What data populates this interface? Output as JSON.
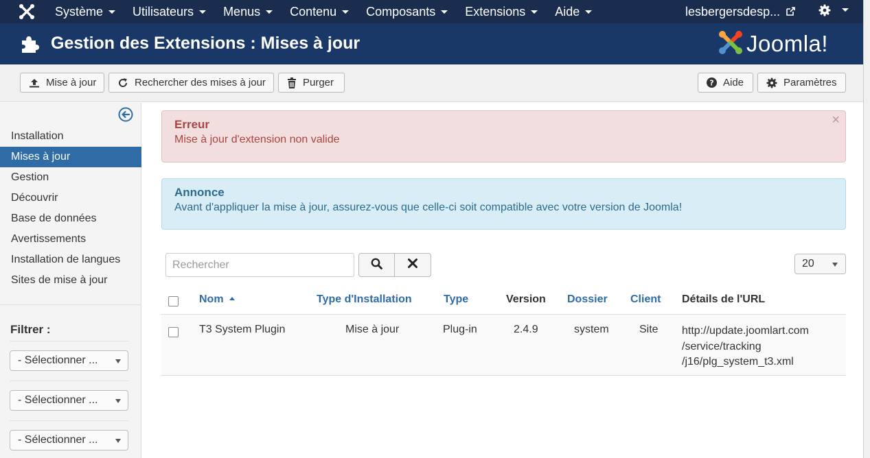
{
  "topnav": {
    "menu": [
      {
        "label": "Système"
      },
      {
        "label": "Utilisateurs"
      },
      {
        "label": "Menus"
      },
      {
        "label": "Contenu"
      },
      {
        "label": "Composants"
      },
      {
        "label": "Extensions"
      },
      {
        "label": "Aide"
      }
    ],
    "user": "lesbergersdesp..."
  },
  "header": {
    "title": "Gestion des Extensions : Mises à jour",
    "brand": "Joomla!"
  },
  "toolbar": {
    "update_label": "Mise à jour",
    "find_label": "Rechercher des mises à jour",
    "purge_label": "Purger",
    "help_label": "Aide",
    "options_label": "Paramètres"
  },
  "sidebar": {
    "items": [
      {
        "label": "Installation"
      },
      {
        "label": "Mises à jour"
      },
      {
        "label": "Gestion"
      },
      {
        "label": "Découvrir"
      },
      {
        "label": "Base de données"
      },
      {
        "label": "Avertissements"
      },
      {
        "label": "Installation de langues"
      },
      {
        "label": "Sites de mise à jour"
      }
    ],
    "active_index": 1,
    "filter_label": "Filtrer :",
    "filters": [
      {
        "value": "- Sélectionner ..."
      },
      {
        "value": "- Sélectionner ..."
      },
      {
        "value": "- Sélectionner ..."
      }
    ]
  },
  "alerts": {
    "error": {
      "heading": "Erreur",
      "message": "Mise à jour d'extension non valide"
    },
    "info": {
      "heading": "Annonce",
      "message": "Avant d'appliquer la mise à jour, assurez-vous que celle-ci soit compatible avec votre version de Joomla!"
    }
  },
  "search": {
    "placeholder": "Rechercher"
  },
  "list_limit": "20",
  "table": {
    "headers": {
      "name": "Nom",
      "install_type": "Type d'Installation",
      "type": "Type",
      "version": "Version",
      "folder": "Dossier",
      "client": "Client",
      "url": "Détails de l'URL"
    },
    "rows": [
      {
        "name": "T3 System Plugin",
        "install_type": "Mise à jour",
        "type": "Plug-in",
        "version": "2.4.9",
        "folder": "system",
        "client": "Site",
        "url_lines": [
          "http://update.joomlart.com",
          "/service/tracking",
          "/j16/plg_system_t3.xml"
        ]
      }
    ]
  },
  "colors": {
    "navbar": "#1b2d4f",
    "titlebar": "#1a3867",
    "active": "#2f6ca5",
    "link": "#2f6ca5",
    "error_bg": "#f2dede",
    "info_bg": "#d9edf7"
  }
}
